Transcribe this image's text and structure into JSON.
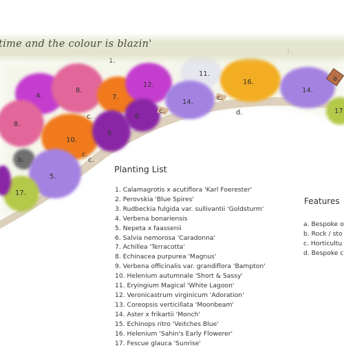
{
  "banner": {
    "script_title": "time and the colour is blazin'"
  },
  "planting": {
    "heading": "Planting List",
    "items": [
      "1. Calamagrotis x acutiflora 'Karl Foerester'",
      "2. Perovskia 'Blue Spires'",
      "3. Rudbeckia fulgida var. sullivantii 'Goldsturm'",
      "4. Verbena bonariensis",
      "5. Nepeta x faassenii",
      "6. Salvia nemorosa 'Caradonna'",
      "7. Achillea 'Terracotta'",
      "8. Echinacea purpurea 'Magnus'",
      "9. Verbena officinalis var. grandiflora 'Bampton'",
      "10. Helenium autumnale 'Short & Sassy'",
      "11. Eryingium Magical 'White Lagoon'",
      "12. Veronicastrum virginicum 'Adoration'",
      "13. Coreopsis verticillata 'Moonbeam'",
      "14. Aster x frikartii 'Monch'",
      "15. Echinops ritro 'Veitches Blue'",
      "16. Helenium 'Sahin's Early Flowerer'",
      "17. Fescue glauca 'Sunrise'"
    ]
  },
  "features": {
    "heading": "Features",
    "items": [
      "a. Bespoke o",
      "b. Rock / sto",
      "c. Horticultu",
      "d. Bespoke c"
    ]
  },
  "plan": {
    "colors": {
      "magenta": "#c43ecf",
      "pink": "#e2669a",
      "orange": "#f07a1e",
      "dark_purple": "#8a27a6",
      "lavender": "#a482e2",
      "yellow_orange": "#f3ad22",
      "white": "#e6e6ee",
      "grey": "#6f6f6f",
      "yellow_green": "#b4c84a",
      "path": "#ddd0bc"
    },
    "plants": [
      {
        "label": "1.",
        "color": "none"
      },
      {
        "label": "1.",
        "color": "none"
      },
      {
        "label": "4.",
        "color": "magenta"
      },
      {
        "label": "8.",
        "color": "pink"
      },
      {
        "label": "7.",
        "color": "orange"
      },
      {
        "label": "12.",
        "color": "magenta"
      },
      {
        "label": "11.",
        "color": "white"
      },
      {
        "label": "16.",
        "color": "yellow_orange"
      },
      {
        "label": "14.",
        "color": "lavender"
      },
      {
        "label": "14.",
        "color": "lavender"
      },
      {
        "label": "6.",
        "color": "dark_purple"
      },
      {
        "label": "8.",
        "color": "pink"
      },
      {
        "label": "10.",
        "color": "orange"
      },
      {
        "label": "6.",
        "color": "dark_purple"
      },
      {
        "label": "b.",
        "color": "grey"
      },
      {
        "label": "5.",
        "color": "lavender"
      },
      {
        "label": "17.",
        "color": "yellow_green"
      },
      {
        "label": "17.",
        "color": "yellow_green"
      }
    ],
    "feature_marks": [
      {
        "label": "c."
      },
      {
        "label": "c."
      },
      {
        "label": "c."
      },
      {
        "label": "c."
      },
      {
        "label": "c."
      },
      {
        "label": "d."
      },
      {
        "label": "a."
      }
    ]
  }
}
